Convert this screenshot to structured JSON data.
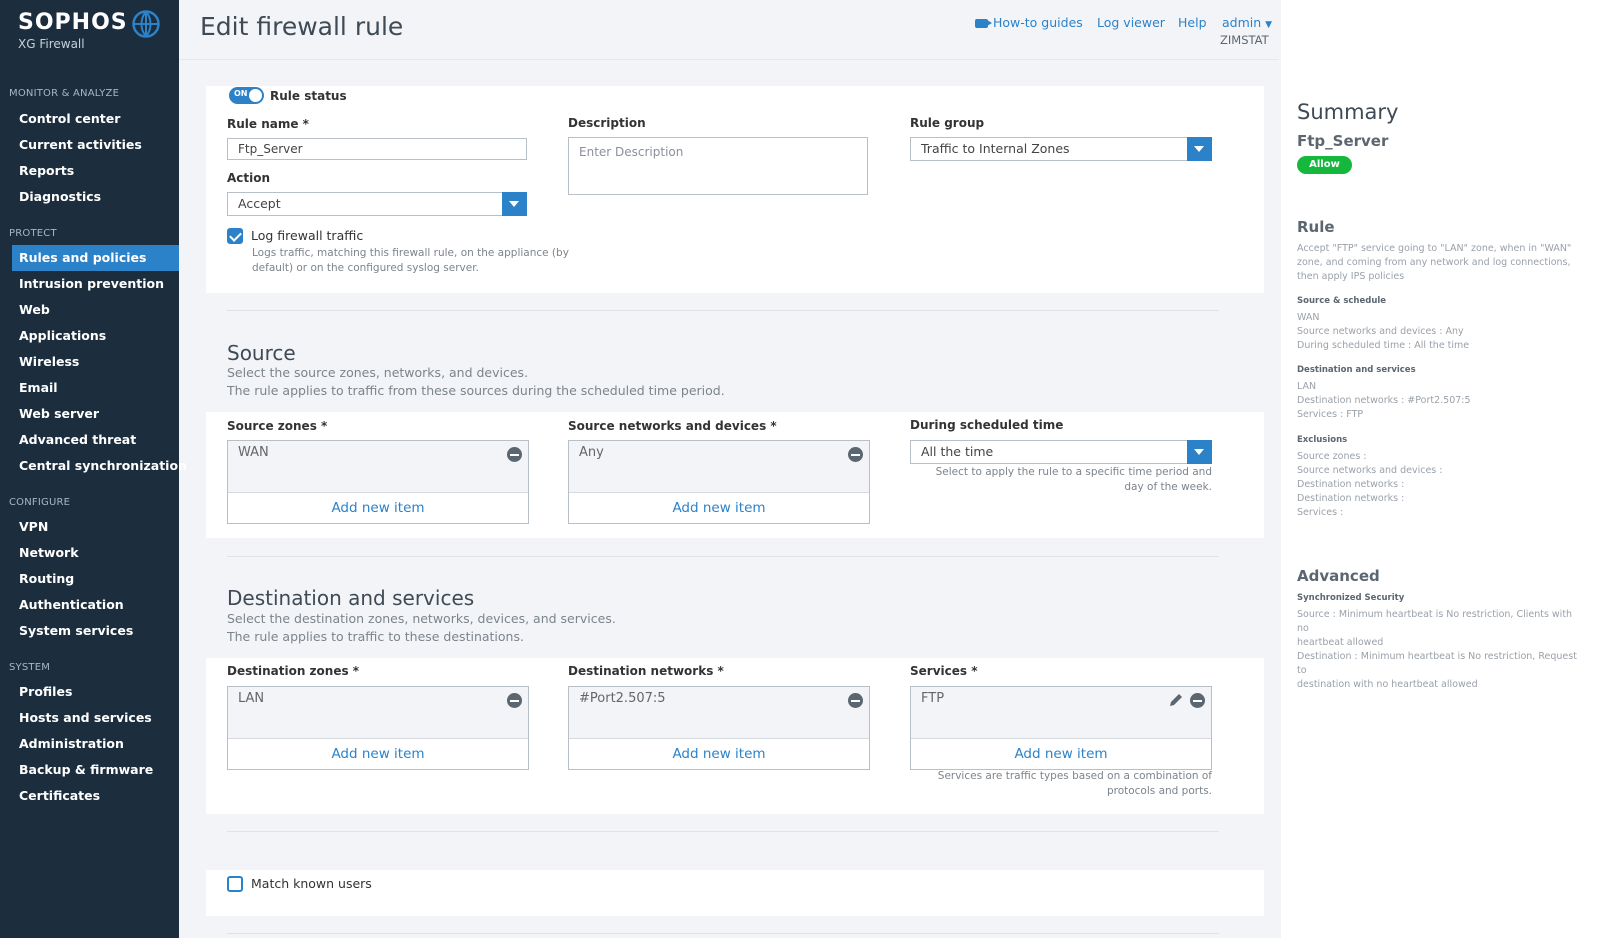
{
  "brand": {
    "name": "SOPHOS",
    "product": "XG Firewall"
  },
  "nav": {
    "sections": [
      {
        "title": "MONITOR & ANALYZE",
        "items": [
          "Control center",
          "Current activities",
          "Reports",
          "Diagnostics"
        ]
      },
      {
        "title": "PROTECT",
        "items": [
          "Rules and policies",
          "Intrusion prevention",
          "Web",
          "Applications",
          "Wireless",
          "Email",
          "Web server",
          "Advanced threat",
          "Central synchronization"
        ]
      },
      {
        "title": "CONFIGURE",
        "items": [
          "VPN",
          "Network",
          "Routing",
          "Authentication",
          "System services"
        ]
      },
      {
        "title": "SYSTEM",
        "items": [
          "Profiles",
          "Hosts and services",
          "Administration",
          "Backup & firmware",
          "Certificates"
        ]
      }
    ],
    "active": "Rules and policies"
  },
  "header": {
    "title": "Edit firewall rule",
    "howto": "How-to guides",
    "logviewer": "Log viewer",
    "help": "Help",
    "user": "admin",
    "org": "ZIMSTAT"
  },
  "rule": {
    "status_toggle": "ON",
    "status_label": "Rule status",
    "name_label": "Rule name *",
    "name_value": "Ftp_Server",
    "description_label": "Description",
    "description_placeholder": "Enter Description",
    "group_label": "Rule group",
    "group_value": "Traffic to Internal Zones",
    "action_label": "Action",
    "action_value": "Accept",
    "log_label": "Log firewall traffic",
    "log_hint_1": "Logs traffic, matching this firewall rule, on the appliance (by",
    "log_hint_2": "default) or on the configured syslog server."
  },
  "source": {
    "title": "Source",
    "desc_1": "Select the source zones, networks, and devices.",
    "desc_2": "The rule applies to traffic from these sources during the scheduled time period.",
    "zones_label": "Source zones *",
    "zones_item": "WAN",
    "networks_label": "Source networks and devices *",
    "networks_item": "Any",
    "schedule_label": "During scheduled time",
    "schedule_value": "All the time",
    "schedule_hint_1": "Select to apply the rule to a specific time period and",
    "schedule_hint_2": "day of the week.",
    "add_label": "Add new item"
  },
  "destination": {
    "title": "Destination and services",
    "desc_1": "Select the destination zones, networks, devices, and services.",
    "desc_2": "The rule applies to traffic to these destinations.",
    "zones_label": "Destination zones *",
    "zones_item": "LAN",
    "networks_label": "Destination networks *",
    "networks_item": "#Port2.507:5",
    "services_label": "Services *",
    "services_item": "FTP",
    "services_hint_1": "Services are traffic types based on a combination of",
    "services_hint_2": "protocols and ports.",
    "add_label": "Add new item"
  },
  "match_users": {
    "label": "Match known users"
  },
  "summary": {
    "title": "Summary",
    "rule_name": "Ftp_Server",
    "badge": "Allow",
    "rule_heading": "Rule",
    "rule_desc_1": "Accept \"FTP\" service going to \"LAN\" zone, when in \"WAN\"",
    "rule_desc_2": "zone, and coming from any network and log connections,",
    "rule_desc_3": "then apply IPS policies",
    "src_heading": "Source & schedule",
    "src_1": "WAN",
    "src_2": "Source networks and devices : Any",
    "src_3": "During scheduled time : All the time",
    "dst_heading": "Destination and services",
    "dst_1": "LAN",
    "dst_2": "Destination networks : #Port2.507:5",
    "dst_3": "Services : FTP",
    "exc_heading": "Exclusions",
    "exc_1": "Source zones :",
    "exc_2": "Source networks and devices :",
    "exc_3": "Destination networks :",
    "exc_4": "Destination networks :",
    "exc_5": "Services :",
    "adv_heading": "Advanced",
    "sync_heading": "Synchronized Security",
    "adv_1": "Source : Minimum heartbeat is No restriction, Clients with no",
    "adv_2": "heartbeat allowed",
    "adv_3": "Destination : Minimum heartbeat is No restriction, Request to",
    "adv_4": "destination with no heartbeat allowed"
  },
  "colors": {
    "accent": "#2c82c9",
    "sidebar": "#1c2e3d",
    "allow": "#15b83d"
  }
}
